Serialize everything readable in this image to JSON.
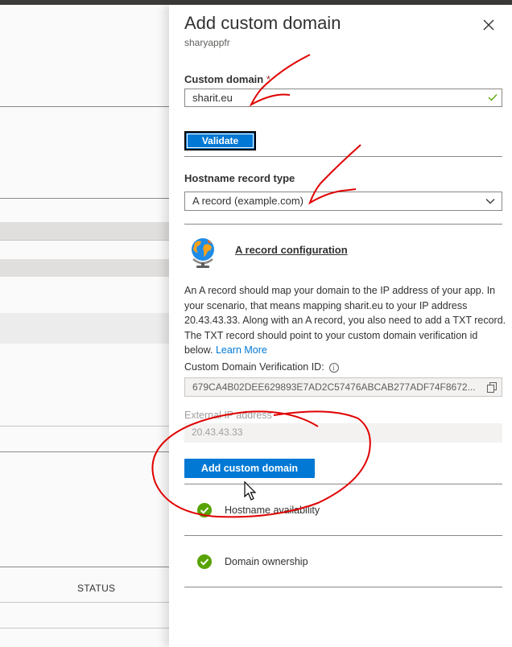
{
  "background": {
    "status_header": "STATUS"
  },
  "panel": {
    "title": "Add custom domain",
    "subtitle": "sharyappfr",
    "custom_domain": {
      "label": "Custom domain",
      "required_marker": "*",
      "value": "sharit.eu",
      "valid": true
    },
    "validate_label": "Validate",
    "hostname_record_type": {
      "label": "Hostname record type",
      "selected": "A record (example.com)"
    },
    "a_record": {
      "heading": "A record configuration",
      "description": "An A record should map your domain to the IP address of your app. In your scenario, that means mapping sharit.eu to your IP address 20.43.43.33. Along with an A record, you also need to add a TXT record. The TXT record should point to your custom domain verification id below.",
      "learn_more": "Learn More"
    },
    "verification_id": {
      "label": "Custom Domain Verification ID:",
      "value": "679CA4B02DEE629893E7AD2C57476ABCAB277ADF74F8672..."
    },
    "external_ip": {
      "label": "External IP address",
      "value": "20.43.43.33"
    },
    "add_button_label": "Add custom domain",
    "checks": [
      {
        "label": "Hostname availability",
        "status": "passed"
      },
      {
        "label": "Domain ownership",
        "status": "passed"
      }
    ]
  },
  "colors": {
    "accent": "#0078d4",
    "success": "#57a300",
    "annotation": "#e00000"
  },
  "icons": [
    "close-icon",
    "checkmark-icon",
    "chevron-down-icon",
    "globe-icon",
    "info-icon",
    "copy-icon",
    "success-check-icon",
    "mouse-cursor-icon"
  ]
}
